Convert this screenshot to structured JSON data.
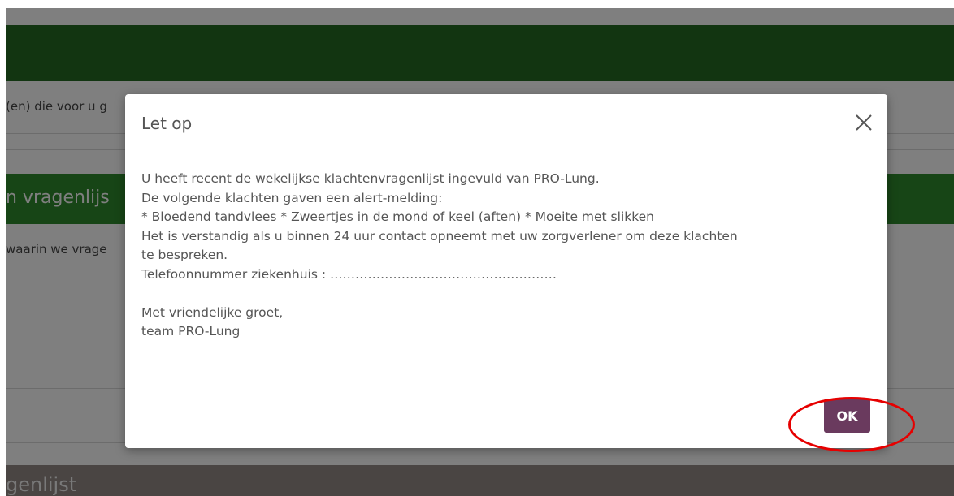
{
  "background": {
    "row1_text": "(en) die voor u g",
    "green_mid_text": "n vragenlijs",
    "row3_text": "waarin we vrage",
    "bottom_bar_text": "genlijst"
  },
  "modal": {
    "title": "Let op",
    "close_icon": "close-icon",
    "body": {
      "line1": "U heeft recent de wekelijkse klachtenvragenlijst ingevuld van PRO-Lung.",
      "line2": "De volgende klachten gaven een alert-melding:",
      "line3": "* Bloedend tandvlees * Zweertjes in de mond of keel (aften) * Moeite met slikken",
      "line4": "Het is verstandig als u binnen 24 uur contact opneemt met uw zorgverlener om deze klachten",
      "line5": "te bespreken.",
      "line6": "Telefoonnummer ziekenhuis : ………………………………………………",
      "line7": "Met vriendelijke groet,",
      "line8": "team PRO-Lung"
    },
    "ok_label": "OK"
  },
  "colors": {
    "ok_button": "#6a3a5e",
    "annotation": "#e60000",
    "header_green": "#246b22"
  }
}
